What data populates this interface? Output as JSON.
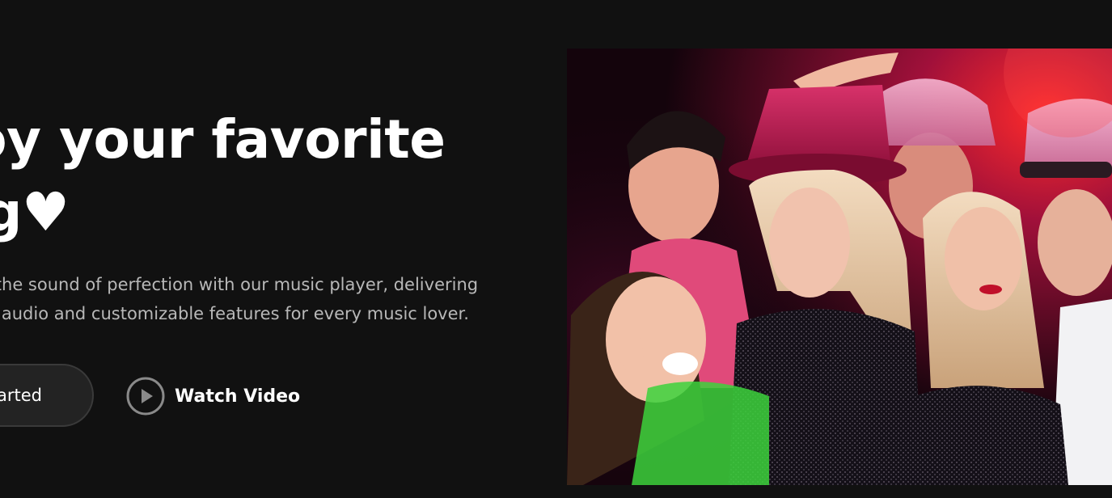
{
  "hero": {
    "title_line1": "Enjoy your favorite",
    "title_line2": "song♥",
    "description_line1": "Experience the sound of perfection with our music player, delivering",
    "description_line2": "high-quality audio and customizable features for every music lover.",
    "get_started_label": "Get Started",
    "watch_video_label": "Watch Video"
  },
  "icons": {
    "play": "play-circle-icon"
  },
  "colors": {
    "background": "#111111",
    "text_primary": "#ffffff",
    "text_secondary": "#b8b8b8",
    "button_bg": "#232323",
    "button_border": "#3a3a3a",
    "photo_accent_pink": "#e0266a",
    "photo_accent_red": "#ff2a2a"
  }
}
